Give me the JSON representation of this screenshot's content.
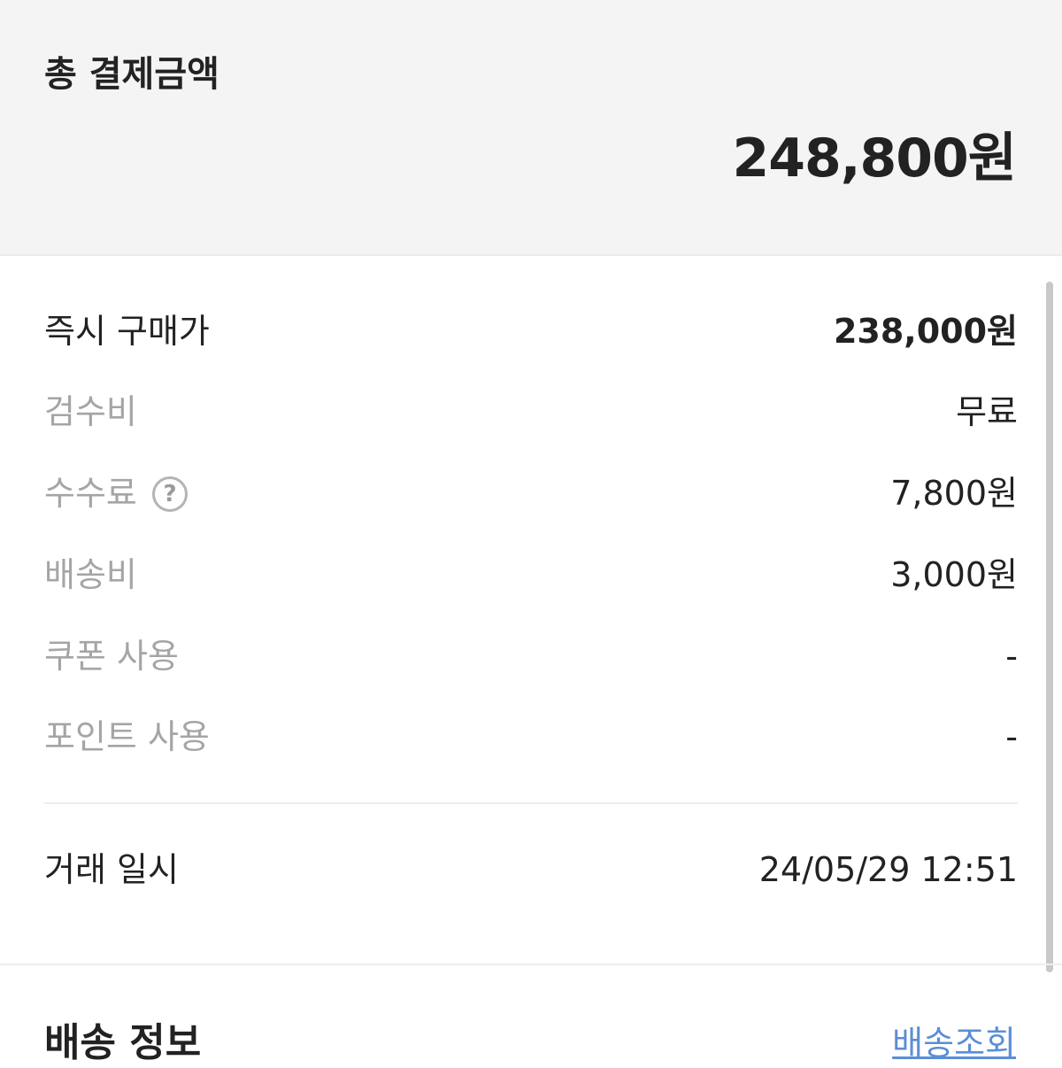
{
  "summary": {
    "title": "총 결제금액",
    "amount": "248,800원"
  },
  "breakdown": {
    "items": [
      {
        "label": "즉시 구매가",
        "value": "238,000원"
      },
      {
        "label": "검수비",
        "value": "무료"
      },
      {
        "label": "수수료",
        "value": "7,800원",
        "help_icon": "?"
      },
      {
        "label": "배송비",
        "value": "3,000원"
      },
      {
        "label": "쿠폰 사용",
        "value": "-"
      },
      {
        "label": "포인트 사용",
        "value": "-"
      }
    ]
  },
  "transaction": {
    "label": "거래 일시",
    "value": "24/05/29 12:51"
  },
  "delivery": {
    "title": "배송 정보",
    "track_link": "배송조회"
  },
  "colors": {
    "summary_bg": "#f4f4f4",
    "text_primary": "#222222",
    "text_muted": "#a5a5a5",
    "link": "#5b8ed6"
  },
  "icons": {
    "help": "help-icon"
  }
}
